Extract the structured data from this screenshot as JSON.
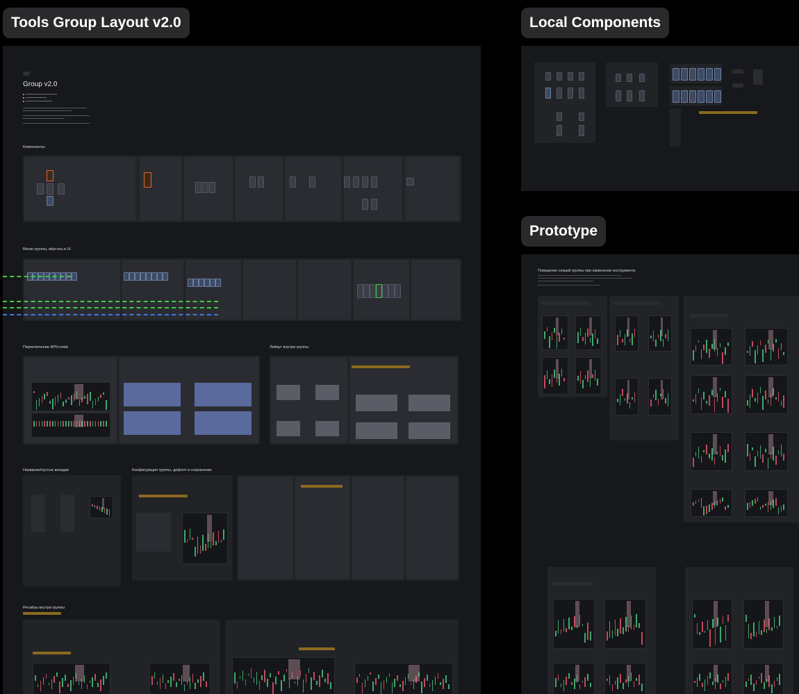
{
  "frames": {
    "tools": {
      "title": "Tools Group Layout v2.0"
    },
    "local": {
      "title": "Local Components"
    },
    "prototype": {
      "title": "Prototype"
    }
  },
  "doc": {
    "heading": "Group v2.0",
    "sections": {
      "components": "Компоненты",
      "menu": "Меню группы, вёрстка и UI",
      "api": "Переключение API/слоёв",
      "layout": "Лейаут внутри группы",
      "tabs": "Название/пустые вкладки",
      "config": "Конфигурация группы, дефолт и сохранение",
      "resize": "Ресайзы внутри группы"
    }
  },
  "prototype": {
    "heading": "Поведение секций группы при изменении инструмента"
  },
  "colors": {
    "background": "#000000",
    "frame": "#17181b",
    "panel": "#222327",
    "accent_green": "#3fcf3f",
    "accent_blue": "#3d7be8",
    "accent_orange": "#e0682b",
    "accent_yellow": "#8a6b1f",
    "chart_red": "#c24a5a",
    "chart_green": "#3fa96b"
  }
}
